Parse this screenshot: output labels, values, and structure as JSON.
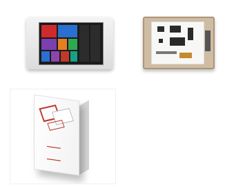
{
  "gallery": {
    "items": [
      {
        "id": "product-1",
        "type": "display-front"
      },
      {
        "id": "product-2",
        "type": "display-back"
      },
      {
        "id": "product-3",
        "type": "retail-box"
      }
    ]
  }
}
